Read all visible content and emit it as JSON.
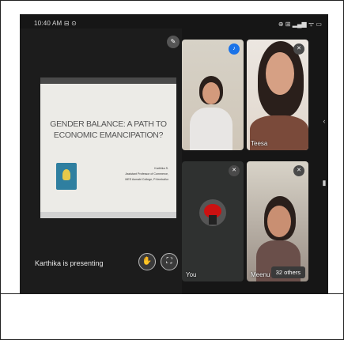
{
  "status_bar": {
    "left": "10:40 AM ⊟ ⊙",
    "right": "⊕ ⊞ ▂▄▆ ᯤ ▭"
  },
  "presentation": {
    "slide_title": "GENDER BALANCE: A PATH TO ECONOMIC EMANCIPATION?",
    "author_lines": [
      "Karthika S.",
      "Assistant Professor of Commerce,",
      "MES Asmabi College, P.Vemballur"
    ],
    "presenting_text": "Karthika is presenting"
  },
  "tiles": [
    {
      "name": ""
    },
    {
      "name": "Teesa"
    },
    {
      "name": "You"
    },
    {
      "name": "Meenu"
    }
  ],
  "others_button": "32 others",
  "colors": {
    "screen_bg": "#161616",
    "active_mic": "#1a73e8"
  }
}
